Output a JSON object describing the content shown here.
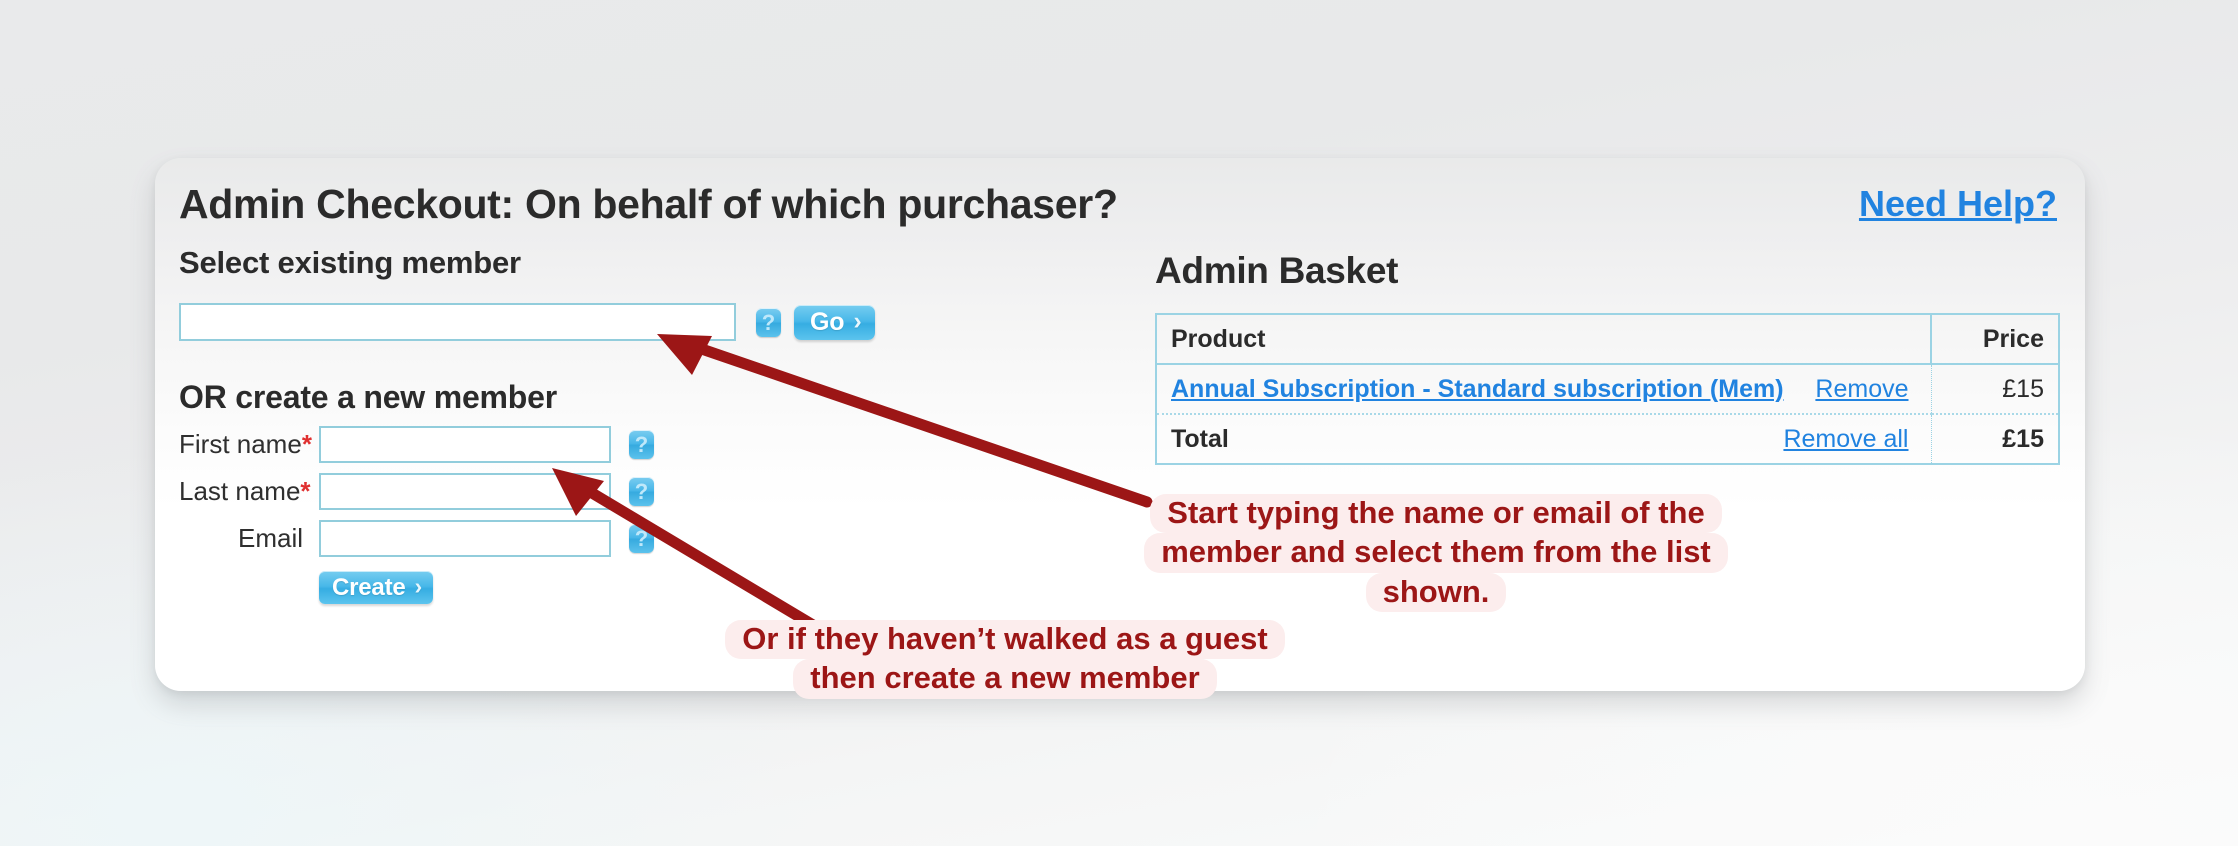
{
  "header": {
    "title": "Admin Checkout: On behalf of which purchaser?",
    "need_help_label": "Need Help?"
  },
  "select_existing": {
    "heading": "Select existing member",
    "search_value": "",
    "search_placeholder": "",
    "help_icon": "question-mark-icon",
    "go_label": "Go",
    "go_chevron": "›"
  },
  "create_member": {
    "heading": "OR create a new member",
    "fields": [
      {
        "label": "First name",
        "required": true,
        "value": "",
        "help_icon": "question-mark-icon"
      },
      {
        "label": "Last name",
        "required": true,
        "value": "",
        "help_icon": "question-mark-icon"
      },
      {
        "label": "Email",
        "required": false,
        "value": "",
        "help_icon": "question-mark-icon"
      }
    ],
    "required_marker": "*",
    "create_label": "Create",
    "create_chevron": "›"
  },
  "basket": {
    "title": "Admin Basket",
    "columns": [
      "Product",
      "Price"
    ],
    "rows": [
      {
        "product": "Annual Subscription - Standard subscription (Mem)",
        "action": "Remove",
        "price": "£15"
      }
    ],
    "total": {
      "label": "Total",
      "action": "Remove all",
      "price": "£15"
    }
  },
  "annotations": [
    {
      "name": "search-hint",
      "lines": [
        "Start typing the name or email of the",
        "member and select them from the list",
        "shown."
      ]
    },
    {
      "name": "create-hint",
      "lines": [
        "Or if they haven’t walked as a guest",
        "then create a new member"
      ]
    }
  ],
  "colors": {
    "link": "#2183e0",
    "annotation_text": "#9c1616",
    "annotation_bg": "#fceded",
    "arrow": "#9c1616",
    "field_border": "#92cddc",
    "button_blue": "#46b8e9",
    "required": "#e03030"
  }
}
